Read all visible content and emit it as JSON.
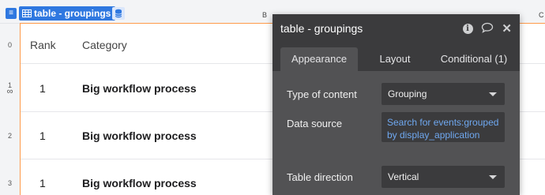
{
  "canvas": {
    "element_tag": "table - groupings",
    "column_letters": [
      "B",
      "C"
    ],
    "row_numbers": [
      "0",
      "1",
      "2",
      "3"
    ],
    "row_icon": "infinity-icon"
  },
  "table": {
    "headers": {
      "rank": "Rank",
      "category": "Category"
    },
    "rows": [
      {
        "rank": "1",
        "category": "Big workflow process"
      },
      {
        "rank": "1",
        "category": "Big workflow process"
      },
      {
        "rank": "1",
        "category": "Big workflow process"
      }
    ]
  },
  "panel": {
    "title": "table - groupings",
    "icons": [
      "info-icon",
      "comment-icon",
      "close-icon"
    ],
    "tabs": [
      {
        "label": "Appearance",
        "active": true
      },
      {
        "label": "Layout",
        "active": false
      },
      {
        "label": "Conditional (1)",
        "active": false
      }
    ],
    "properties": {
      "type_label": "Type of content",
      "type_value": "Grouping",
      "source_label": "Data source",
      "source_value": "Search for events:grouped by display_application",
      "direction_label": "Table direction",
      "direction_value": "Vertical"
    }
  },
  "colors": {
    "accent": "#2f78e0",
    "selection": "#ff9a4a",
    "panel_header": "#3b3b3d",
    "panel_body": "#525254",
    "link": "#6fa8f0"
  }
}
